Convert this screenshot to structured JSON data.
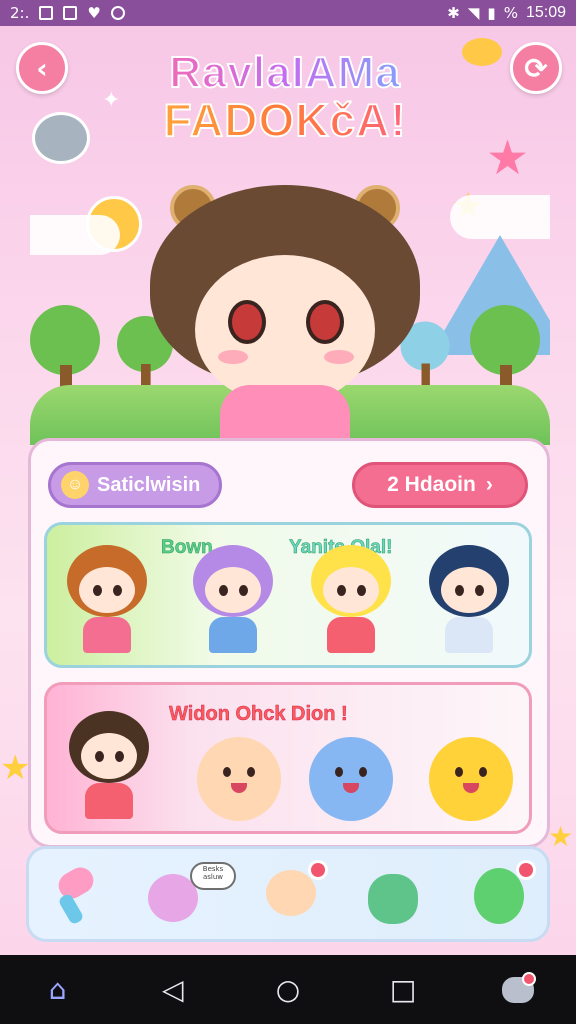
{
  "status_bar": {
    "left_text": "2:.",
    "battery_text": "%",
    "time": "15:09"
  },
  "header": {
    "back_icon": "chevron-left-icon",
    "refresh_icon": "refresh-icon",
    "title_line1": "RavlaIAMa",
    "title_line2": "FADOKčA!"
  },
  "panel": {
    "chip_label": "Saticlwisin",
    "action_button_label": "2  Hdaoin",
    "action_button_icon": "chevron-right-icon"
  },
  "card1": {
    "label_left": "Bown",
    "label_right": "Yanite Olal!"
  },
  "card2": {
    "label": "Widon Ohck Dion !"
  },
  "tray": {
    "speech_text": "Besks asluw"
  },
  "navbar": {
    "home_icon": "home-icon",
    "back_icon": "back-triangle-icon",
    "circle_icon": "home-circle-icon",
    "recents_icon": "recents-square-icon",
    "assistant_icon": "chat-bot-icon"
  },
  "colors": {
    "status_bar": "#8a4f9b",
    "accent_pink": "#f46e92",
    "accent_purple": "#c79be6"
  }
}
